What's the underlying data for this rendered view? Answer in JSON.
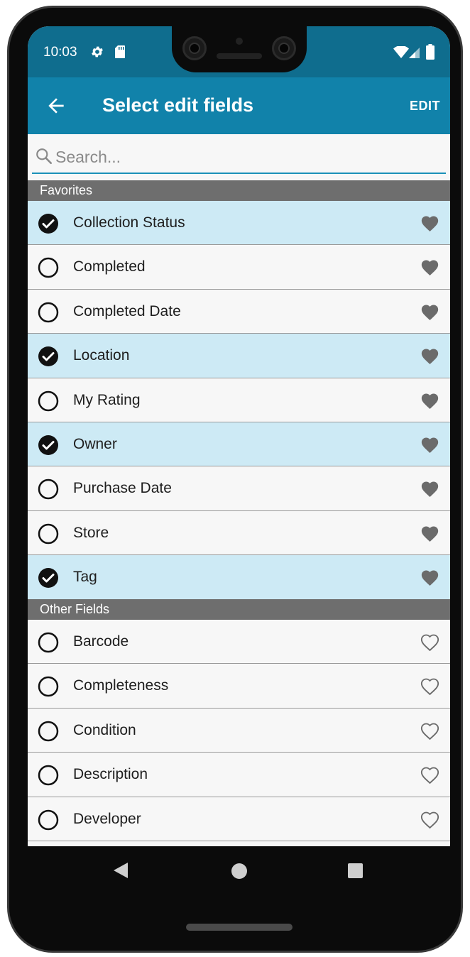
{
  "status": {
    "time": "10:03",
    "icons": [
      "gear-icon",
      "sd-card-icon",
      "wifi-icon",
      "signal-icon",
      "battery-icon"
    ]
  },
  "appbar": {
    "title": "Select edit fields",
    "action_label": "EDIT",
    "back_icon": "arrow-left-icon"
  },
  "search": {
    "placeholder": "Search...",
    "value": ""
  },
  "sections": [
    {
      "header": "Favorites",
      "rows": [
        {
          "label": "Collection Status",
          "checked": true,
          "favorite": true
        },
        {
          "label": "Completed",
          "checked": false,
          "favorite": true
        },
        {
          "label": "Completed Date",
          "checked": false,
          "favorite": true
        },
        {
          "label": "Location",
          "checked": true,
          "favorite": true
        },
        {
          "label": "My Rating",
          "checked": false,
          "favorite": true
        },
        {
          "label": "Owner",
          "checked": true,
          "favorite": true
        },
        {
          "label": "Purchase Date",
          "checked": false,
          "favorite": true
        },
        {
          "label": "Store",
          "checked": false,
          "favorite": true
        },
        {
          "label": "Tag",
          "checked": true,
          "favorite": true
        }
      ]
    },
    {
      "header": "Other Fields",
      "rows": [
        {
          "label": "Barcode",
          "checked": false,
          "favorite": false
        },
        {
          "label": "Completeness",
          "checked": false,
          "favorite": false
        },
        {
          "label": "Condition",
          "checked": false,
          "favorite": false
        },
        {
          "label": "Description",
          "checked": false,
          "favorite": false
        },
        {
          "label": "Developer",
          "checked": false,
          "favorite": false
        }
      ]
    }
  ],
  "colors": {
    "statusbar": "#0f6d8e",
    "appbar": "#1182aa",
    "selected_row": "#cdeaf5",
    "section_header": "#6e6e6e",
    "heart": "#6b6b6b"
  }
}
